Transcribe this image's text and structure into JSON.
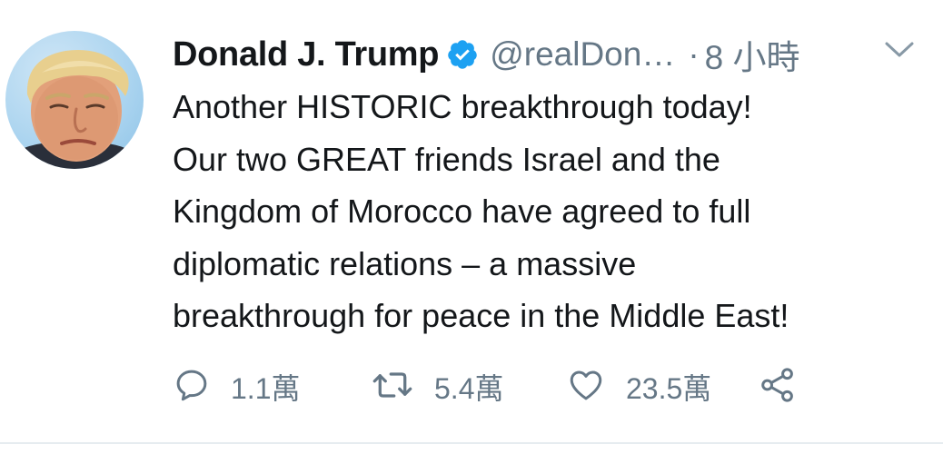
{
  "tweet": {
    "display_name": "Donald J. Trump",
    "handle": "@realDon…",
    "separator": "·",
    "time": "8 小時",
    "text_lines": [
      "Another HISTORIC breakthrough today!",
      "Our two GREAT friends Israel and the",
      "Kingdom of Morocco have agreed to full",
      "diplomatic relations – a massive",
      "breakthrough for peace in the Middle East!"
    ],
    "actions": {
      "reply_count": "1.1萬",
      "retweet_count": "5.4萬",
      "like_count": "23.5萬"
    }
  },
  "icons": {
    "verified": "verified-badge-icon",
    "caret": "chevron-down-icon",
    "reply": "reply-icon",
    "retweet": "retweet-icon",
    "like": "heart-icon",
    "share": "share-icon"
  },
  "colors": {
    "text_primary": "#14171a",
    "text_secondary": "#657786",
    "verified_blue": "#1da1f2"
  }
}
